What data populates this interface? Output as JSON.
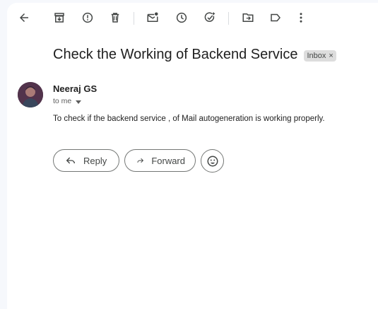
{
  "toolbar": {
    "icons": [
      "back-arrow-icon",
      "archive-icon",
      "report-spam-icon",
      "delete-icon",
      "mark-unread-icon",
      "snooze-icon",
      "add-task-icon",
      "move-to-icon",
      "labels-icon",
      "more-vert-icon"
    ]
  },
  "message": {
    "subject": "Check the Working of Backend Service",
    "label": "Inbox",
    "label_remove": "×",
    "sender": "Neeraj GS",
    "to": "to me",
    "body": "To check if the backend service , of Mail autogeneration is working properly."
  },
  "actions": {
    "reply": "Reply",
    "forward": "Forward"
  },
  "colors": {
    "icon": "#444746",
    "chip_bg": "#dddddd",
    "page_bg": "#f6f8fc"
  }
}
